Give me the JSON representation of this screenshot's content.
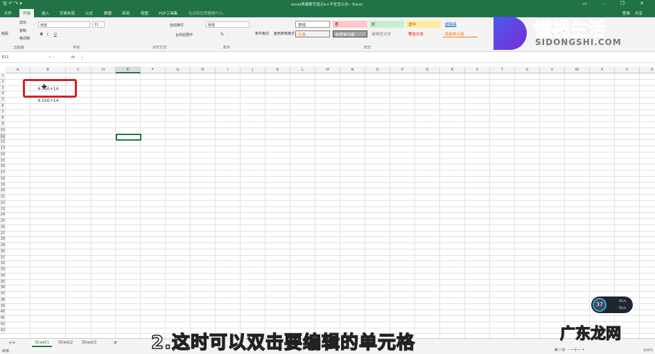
{
  "window": {
    "title": "excel表格数字显示e+不全怎么办 - Excel",
    "quick_access": "🖫 ↶ ↷ ▾",
    "controls": "▭ – ❐ ✕",
    "login": "登录",
    "share": "共享"
  },
  "tabs": [
    "文件",
    "开始",
    "插入",
    "页面布局",
    "公式",
    "数据",
    "审阅",
    "视图",
    "PDF工具集"
  ],
  "tell_me": "告诉我您想要做什么...",
  "ribbon": {
    "clipboard": {
      "paste": "粘贴",
      "cut": "剪切",
      "copy": "复制",
      "format_painter": "格式刷",
      "label": "剪贴板"
    },
    "font": {
      "name": "宋体",
      "size": "11",
      "label": "字体",
      "bold": "B",
      "italic": "I",
      "underline": "U"
    },
    "alignment": {
      "wrap": "自动换行",
      "merge": "合并后居中",
      "label": "对齐方式"
    },
    "number": {
      "format": "常规",
      "percent": "%",
      "comma": ",",
      "label": "数字"
    },
    "styles": {
      "conditional": "条件格式",
      "table": "套用表格格式",
      "label": "样式",
      "items": [
        "常规",
        "差",
        "好",
        "适中",
        "超链接",
        "计算",
        "检查单元格",
        "解释性文本",
        "警告文本",
        "链接单元格"
      ]
    }
  },
  "formula_bar": {
    "name_box": "E11",
    "fx": "fx",
    "value": ""
  },
  "columns": [
    "A",
    "B",
    "C",
    "D",
    "E",
    "F",
    "G",
    "H",
    "I",
    "J",
    "K",
    "L",
    "M",
    "N",
    "O",
    "P",
    "Q",
    "R",
    "S",
    "T",
    "U",
    "V",
    "W",
    "X",
    "Y",
    "Z"
  ],
  "cells": {
    "B3": "6.55E+14",
    "B5": "6.55E+14"
  },
  "sheets": [
    "Sheet1",
    "Sheet2",
    "Sheet3"
  ],
  "status": {
    "ready": "就绪",
    "zoom": "100%"
  },
  "subtitle": "2.这时可以双击要编辑的单元格",
  "watermark": {
    "name": "懂视生活",
    "url": "SIDONGSHI.COM",
    "corner": "广东龙网"
  },
  "perf": {
    "cpu": "37",
    "up": "0k/s",
    "down": "0k/s"
  },
  "colors": {
    "excel_green": "#217346",
    "highlight_red": "#d22020"
  }
}
